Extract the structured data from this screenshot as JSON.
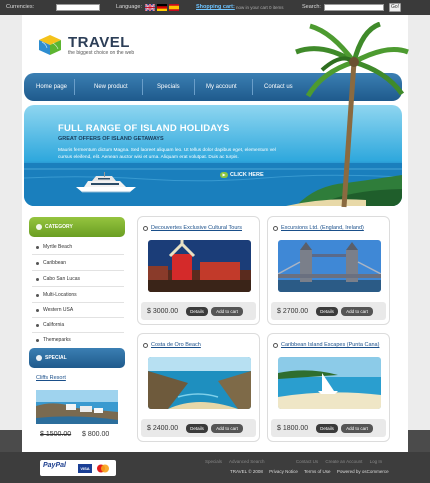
{
  "topbar": {
    "currencies_label": "Currencies:",
    "language_label": "Language:",
    "cart_link": "Shopping cart:",
    "cart_note": "now in your cart 0 items",
    "search_label": "Search:",
    "go_label": "Go!"
  },
  "logo": {
    "title": "TRAVEL",
    "tagline": "the biggest choice on the web"
  },
  "nav": [
    "Home page",
    "New product",
    "Specials",
    "My account",
    "Contact us"
  ],
  "banner": {
    "title": "FULL RANGE OF ISLAND HOLIDAYS",
    "subtitle": "GREAT OFFERS OF ISLAND GETAWAYS",
    "text": "Mauris fermentum dictum Magna. Sed laoreet aliquam leo. Ut tellus dolor dapibus eget, elementum vel cursus eleifend, elit. Aenean auctor wisi et urna. Aliquam erat volutpat. Duis ac turpis.",
    "cta": "CLICK HERE"
  },
  "sidebar": {
    "category_title": "CATEGORY",
    "categories": [
      "Myrtle Beach",
      "Caribbean",
      "Cabo San Lucas",
      "Multi-Locations",
      "Western USA",
      "California",
      "Themeparks"
    ],
    "special_title": "SPECIAL",
    "special": {
      "name": "Cliffs Resort",
      "old_price": "$ 1500.00",
      "new_price": "$ 800.00"
    }
  },
  "products": [
    {
      "title": "Decouvertes Exclusive Cultural Tours",
      "price": "$ 3000.00"
    },
    {
      "title": "Excursions Ltd. (England, Ireland)",
      "price": "$ 2700.00"
    },
    {
      "title": "Costa de Oro Beach",
      "price": "$ 2400.00"
    },
    {
      "title": "Caribbean Island Escapes (Punta Cana)",
      "price": "$ 1800.00"
    }
  ],
  "buttons": {
    "details": "Details",
    "add_to_cart": "Add to cart"
  },
  "footer": {
    "links": [
      "Specials",
      "Advanced Search",
      "Contact Us",
      "Create an Account",
      "Log In"
    ],
    "copyright": "TRAVEL © 2008",
    "bottom_links": [
      "Privacy Notice",
      "Terms of Use",
      "Powered by osCommerce"
    ],
    "payment_paypal": "PayPal",
    "payment_visa": "VISA"
  },
  "colors": {
    "nav": "#2a6a9e",
    "category_head": "#7ab02a",
    "special_head": "#1f5a8c",
    "link": "#1a4f8a"
  }
}
